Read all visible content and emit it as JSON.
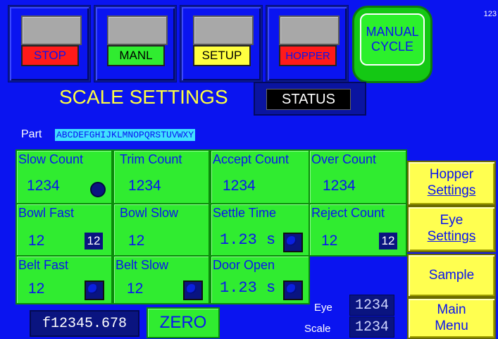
{
  "corner_text": "123",
  "mode_buttons": [
    {
      "label": "STOP",
      "color": "#ff1a1a"
    },
    {
      "label": "MANL",
      "color": "#30ec30"
    },
    {
      "label": "SETUP",
      "color": "#ffff40"
    },
    {
      "label": "HOPPER",
      "color": "#ff1a1a"
    }
  ],
  "manual_cycle": {
    "line1": "MANUAL",
    "line2": "CYCLE"
  },
  "title": "SCALE SETTINGS",
  "status_label": "STATUS",
  "part": {
    "label": "Part",
    "value": "ABCDEFGHIJKLMNOPQRSTUVWXY"
  },
  "cells": {
    "slow_count": {
      "label": "Slow Count",
      "value": "1234"
    },
    "trim_count": {
      "label": "Trim Count",
      "value": "1234"
    },
    "accept_count": {
      "label": "Accept Count",
      "value": "1234"
    },
    "over_count": {
      "label": "Over Count",
      "value": "1234"
    },
    "bowl_fast": {
      "label": "Bowl Fast",
      "value": "12",
      "box": "12"
    },
    "bowl_slow": {
      "label": "Bowl Slow",
      "value": "12"
    },
    "settle_time": {
      "label": "Settle Time",
      "value": "1.23 s"
    },
    "reject_count": {
      "label": "Reject Count",
      "value": "12",
      "box": "12"
    },
    "belt_fast": {
      "label": "Belt Fast",
      "value": "12"
    },
    "belt_slow": {
      "label": "Belt Slow",
      "value": "12"
    },
    "door_open": {
      "label": "Door Open",
      "value": "1.23 s"
    }
  },
  "right_buttons": {
    "hopper": {
      "line1": "Hopper",
      "line2": "Settings"
    },
    "eye": {
      "line1": "Eye",
      "line2": "Settings"
    },
    "sample": {
      "line1": "Sample"
    },
    "main_menu": {
      "line1": "Main",
      "line2": "Menu"
    }
  },
  "bottom": {
    "f_value": "f12345.678",
    "zero_label": "ZERO",
    "eye_label": "Eye",
    "eye_value": "1234",
    "scale_label": "Scale",
    "scale_value": "1234"
  },
  "colors": {
    "background": "#0a14f0",
    "cell": "#30ec30",
    "button": "#ffff50",
    "accent_text": "#ffff40"
  }
}
